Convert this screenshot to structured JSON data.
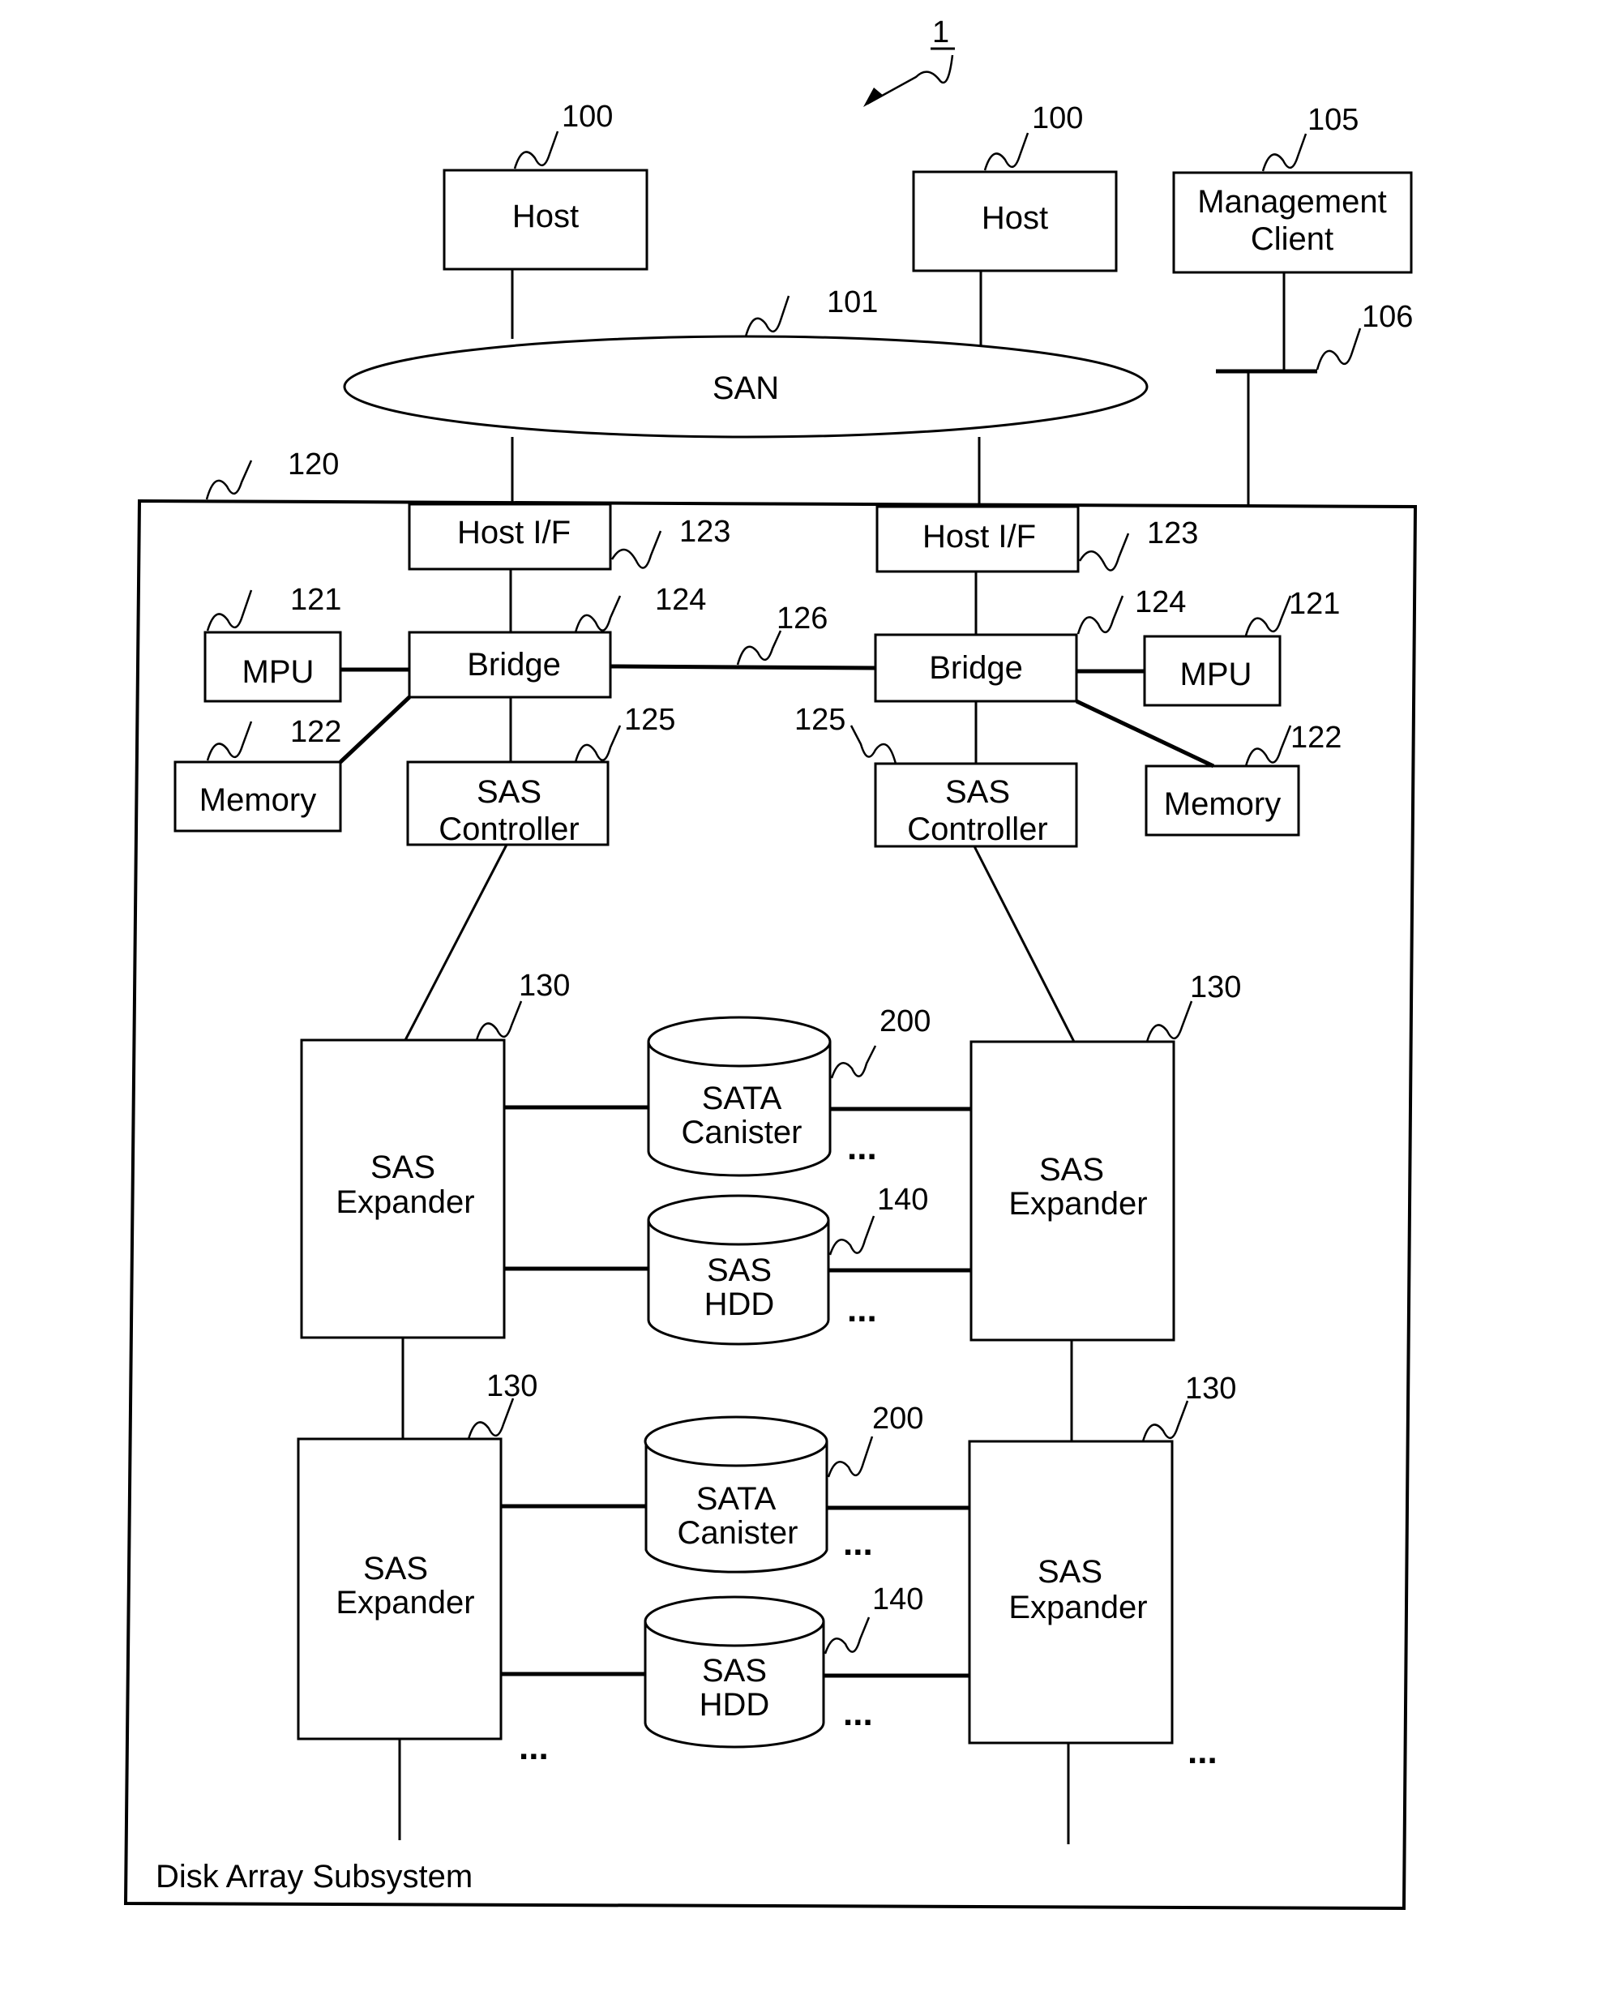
{
  "figure_ref": "1",
  "hosts": [
    {
      "label": "Host",
      "ref": "100"
    },
    {
      "label": "Host",
      "ref": "100"
    }
  ],
  "management_client": {
    "line1": "Management",
    "line2": "Client",
    "ref": "105"
  },
  "management_network_ref": "106",
  "san": {
    "label": "SAN",
    "ref": "101"
  },
  "subsystem": {
    "label": "Disk Array Subsystem",
    "ref": "120"
  },
  "controllers": [
    {
      "host_if": {
        "label": "Host I/F",
        "ref": "123"
      },
      "bridge": {
        "label": "Bridge",
        "ref": "124"
      },
      "mpu": {
        "label": "MPU",
        "ref": "121"
      },
      "memory": {
        "label": "Memory",
        "ref": "122"
      },
      "sas_controller": {
        "line1": "SAS",
        "line2": "Controller",
        "ref": "125"
      }
    },
    {
      "host_if": {
        "label": "Host I/F",
        "ref": "123"
      },
      "bridge": {
        "label": "Bridge",
        "ref": "124"
      },
      "mpu": {
        "label": "MPU",
        "ref": "121"
      },
      "memory": {
        "label": "Memory",
        "ref": "122"
      },
      "sas_controller": {
        "line1": "SAS",
        "line2": "Controller",
        "ref": "125"
      }
    }
  ],
  "bridge_link_ref": "126",
  "expander": {
    "line1": "SAS",
    "line2": "Expander",
    "ref": "130"
  },
  "sata_canister": {
    "line1": "SATA",
    "line2": "Canister",
    "ref": "200"
  },
  "sas_hdd": {
    "line1": "SAS",
    "line2": "HDD",
    "ref": "140"
  },
  "ellipsis": "..."
}
